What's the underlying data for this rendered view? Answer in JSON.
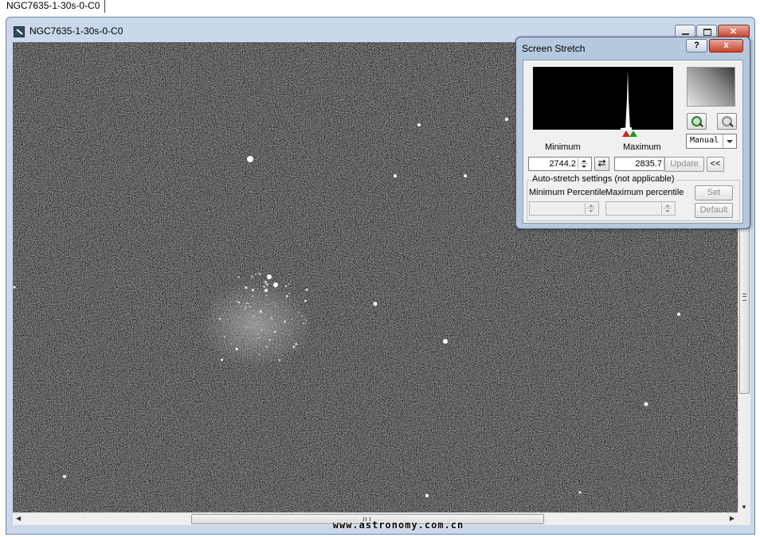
{
  "tab": {
    "label": "NGC7635-1-30s-0-C0"
  },
  "window": {
    "title": "NGC7635-1-30s-0-C0"
  },
  "watermark": "www.astronomy.com.cn",
  "dialog": {
    "title": "Screen Stretch",
    "help_label": "?",
    "close_label": "x",
    "minimum_label": "Minimum",
    "maximum_label": "Maximum",
    "minimum_value": "2744.2",
    "maximum_value": "2835.7",
    "swap_icon": "⇄",
    "mode": "Manual",
    "update_label": "Update",
    "collapse_label": "<<",
    "auto_stretch_title": "Auto-stretch settings (not applicable)",
    "min_percentile_label": "Minimum Percentile",
    "max_percentile_label": "Maximum percentile",
    "set_label": "Set",
    "default_label": "Default"
  },
  "icons": {
    "app": "telescope-app-icon",
    "zoom_in": "zoom-in-icon",
    "zoom_out": "zoom-out-icon",
    "swap": "swap-icon"
  }
}
